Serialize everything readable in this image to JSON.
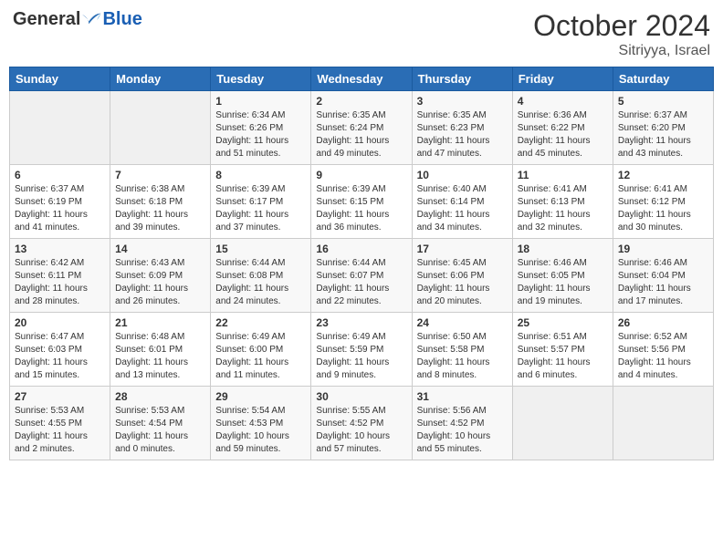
{
  "header": {
    "logo_general": "General",
    "logo_blue": "Blue",
    "month": "October 2024",
    "location": "Sitriyya, Israel"
  },
  "days_of_week": [
    "Sunday",
    "Monday",
    "Tuesday",
    "Wednesday",
    "Thursday",
    "Friday",
    "Saturday"
  ],
  "weeks": [
    [
      {
        "day": "",
        "detail": ""
      },
      {
        "day": "",
        "detail": ""
      },
      {
        "day": "1",
        "detail": "Sunrise: 6:34 AM\nSunset: 6:26 PM\nDaylight: 11 hours and 51 minutes."
      },
      {
        "day": "2",
        "detail": "Sunrise: 6:35 AM\nSunset: 6:24 PM\nDaylight: 11 hours and 49 minutes."
      },
      {
        "day": "3",
        "detail": "Sunrise: 6:35 AM\nSunset: 6:23 PM\nDaylight: 11 hours and 47 minutes."
      },
      {
        "day": "4",
        "detail": "Sunrise: 6:36 AM\nSunset: 6:22 PM\nDaylight: 11 hours and 45 minutes."
      },
      {
        "day": "5",
        "detail": "Sunrise: 6:37 AM\nSunset: 6:20 PM\nDaylight: 11 hours and 43 minutes."
      }
    ],
    [
      {
        "day": "6",
        "detail": "Sunrise: 6:37 AM\nSunset: 6:19 PM\nDaylight: 11 hours and 41 minutes."
      },
      {
        "day": "7",
        "detail": "Sunrise: 6:38 AM\nSunset: 6:18 PM\nDaylight: 11 hours and 39 minutes."
      },
      {
        "day": "8",
        "detail": "Sunrise: 6:39 AM\nSunset: 6:17 PM\nDaylight: 11 hours and 37 minutes."
      },
      {
        "day": "9",
        "detail": "Sunrise: 6:39 AM\nSunset: 6:15 PM\nDaylight: 11 hours and 36 minutes."
      },
      {
        "day": "10",
        "detail": "Sunrise: 6:40 AM\nSunset: 6:14 PM\nDaylight: 11 hours and 34 minutes."
      },
      {
        "day": "11",
        "detail": "Sunrise: 6:41 AM\nSunset: 6:13 PM\nDaylight: 11 hours and 32 minutes."
      },
      {
        "day": "12",
        "detail": "Sunrise: 6:41 AM\nSunset: 6:12 PM\nDaylight: 11 hours and 30 minutes."
      }
    ],
    [
      {
        "day": "13",
        "detail": "Sunrise: 6:42 AM\nSunset: 6:11 PM\nDaylight: 11 hours and 28 minutes."
      },
      {
        "day": "14",
        "detail": "Sunrise: 6:43 AM\nSunset: 6:09 PM\nDaylight: 11 hours and 26 minutes."
      },
      {
        "day": "15",
        "detail": "Sunrise: 6:44 AM\nSunset: 6:08 PM\nDaylight: 11 hours and 24 minutes."
      },
      {
        "day": "16",
        "detail": "Sunrise: 6:44 AM\nSunset: 6:07 PM\nDaylight: 11 hours and 22 minutes."
      },
      {
        "day": "17",
        "detail": "Sunrise: 6:45 AM\nSunset: 6:06 PM\nDaylight: 11 hours and 20 minutes."
      },
      {
        "day": "18",
        "detail": "Sunrise: 6:46 AM\nSunset: 6:05 PM\nDaylight: 11 hours and 19 minutes."
      },
      {
        "day": "19",
        "detail": "Sunrise: 6:46 AM\nSunset: 6:04 PM\nDaylight: 11 hours and 17 minutes."
      }
    ],
    [
      {
        "day": "20",
        "detail": "Sunrise: 6:47 AM\nSunset: 6:03 PM\nDaylight: 11 hours and 15 minutes."
      },
      {
        "day": "21",
        "detail": "Sunrise: 6:48 AM\nSunset: 6:01 PM\nDaylight: 11 hours and 13 minutes."
      },
      {
        "day": "22",
        "detail": "Sunrise: 6:49 AM\nSunset: 6:00 PM\nDaylight: 11 hours and 11 minutes."
      },
      {
        "day": "23",
        "detail": "Sunrise: 6:49 AM\nSunset: 5:59 PM\nDaylight: 11 hours and 9 minutes."
      },
      {
        "day": "24",
        "detail": "Sunrise: 6:50 AM\nSunset: 5:58 PM\nDaylight: 11 hours and 8 minutes."
      },
      {
        "day": "25",
        "detail": "Sunrise: 6:51 AM\nSunset: 5:57 PM\nDaylight: 11 hours and 6 minutes."
      },
      {
        "day": "26",
        "detail": "Sunrise: 6:52 AM\nSunset: 5:56 PM\nDaylight: 11 hours and 4 minutes."
      }
    ],
    [
      {
        "day": "27",
        "detail": "Sunrise: 5:53 AM\nSunset: 4:55 PM\nDaylight: 11 hours and 2 minutes."
      },
      {
        "day": "28",
        "detail": "Sunrise: 5:53 AM\nSunset: 4:54 PM\nDaylight: 11 hours and 0 minutes."
      },
      {
        "day": "29",
        "detail": "Sunrise: 5:54 AM\nSunset: 4:53 PM\nDaylight: 10 hours and 59 minutes."
      },
      {
        "day": "30",
        "detail": "Sunrise: 5:55 AM\nSunset: 4:52 PM\nDaylight: 10 hours and 57 minutes."
      },
      {
        "day": "31",
        "detail": "Sunrise: 5:56 AM\nSunset: 4:52 PM\nDaylight: 10 hours and 55 minutes."
      },
      {
        "day": "",
        "detail": ""
      },
      {
        "day": "",
        "detail": ""
      }
    ]
  ]
}
